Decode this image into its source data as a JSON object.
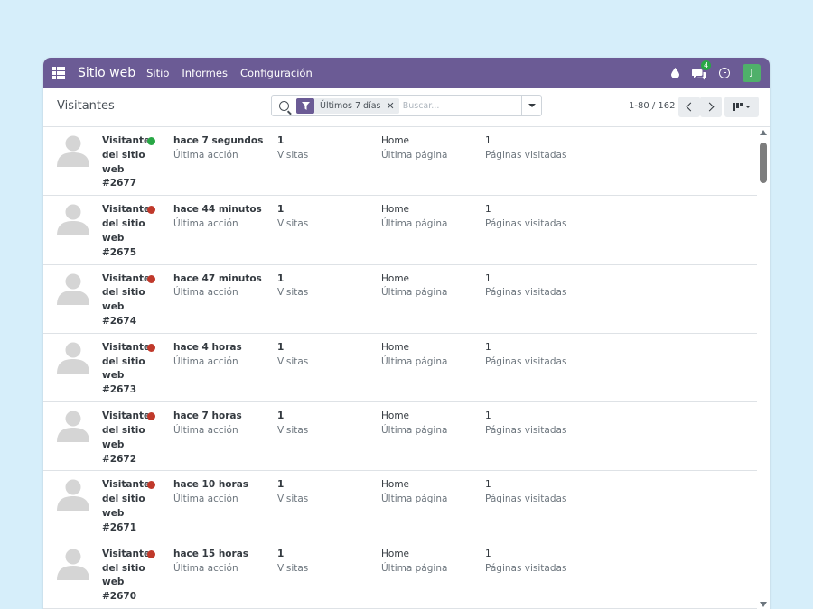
{
  "navbar": {
    "brand": "Sitio web",
    "menu": [
      "Sitio",
      "Informes",
      "Configuración"
    ],
    "chat_count": "4",
    "user_initial": "J",
    "color": "#6b5b95"
  },
  "control": {
    "breadcrumb": "Visitantes",
    "facet_label": "Últimos 7 días",
    "search_placeholder": "Buscar...",
    "pager": "1-80 / 162"
  },
  "labels": {
    "last_action": "Última acción",
    "visits": "Visitas",
    "last_page": "Última página",
    "pages_visited": "Páginas visitadas"
  },
  "visitors": [
    {
      "name": [
        "Visitante",
        "del sitio",
        "web",
        "#2677"
      ],
      "online": true,
      "status_color": "#28a745",
      "last_action": "hace 7 segundos",
      "visits": "1",
      "last_page": "Home",
      "pages": "1"
    },
    {
      "name": [
        "Visitante",
        "del sitio",
        "web",
        "#2675"
      ],
      "online": false,
      "status_color": "#c0392b",
      "last_action": "hace 44 minutos",
      "visits": "1",
      "last_page": "Home",
      "pages": "1"
    },
    {
      "name": [
        "Visitante",
        "del sitio",
        "web",
        "#2674"
      ],
      "online": false,
      "status_color": "#c0392b",
      "last_action": "hace 47 minutos",
      "visits": "1",
      "last_page": "Home",
      "pages": "1"
    },
    {
      "name": [
        "Visitante",
        "del sitio",
        "web",
        "#2673"
      ],
      "online": false,
      "status_color": "#c0392b",
      "last_action": "hace 4 horas",
      "visits": "1",
      "last_page": "Home",
      "pages": "1"
    },
    {
      "name": [
        "Visitante",
        "del sitio",
        "web",
        "#2672"
      ],
      "online": false,
      "status_color": "#c0392b",
      "last_action": "hace 7 horas",
      "visits": "1",
      "last_page": "Home",
      "pages": "1"
    },
    {
      "name": [
        "Visitante",
        "del sitio",
        "web",
        "#2671"
      ],
      "online": false,
      "status_color": "#c0392b",
      "last_action": "hace 10 horas",
      "visits": "1",
      "last_page": "Home",
      "pages": "1"
    },
    {
      "name": [
        "Visitante",
        "del sitio",
        "web",
        "#2670"
      ],
      "online": false,
      "status_color": "#c0392b",
      "last_action": "hace 15 horas",
      "visits": "1",
      "last_page": "Home",
      "pages": "1"
    }
  ]
}
